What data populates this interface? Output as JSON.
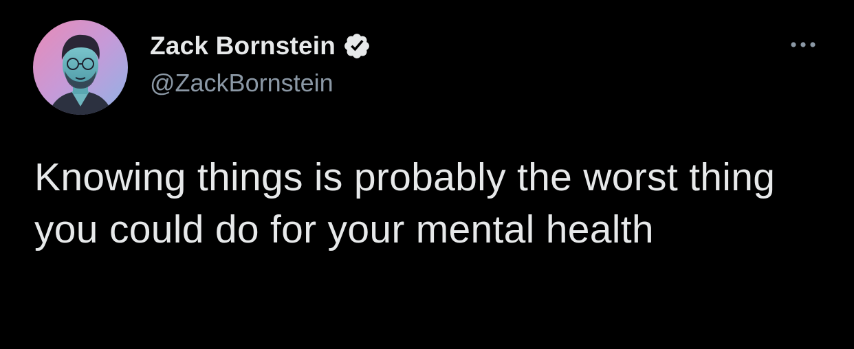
{
  "tweet": {
    "author": {
      "display_name": "Zack Bornstein",
      "handle": "@ZackBornstein",
      "verified": true
    },
    "text": "Knowing things is probably the worst thing you could do for your mental health"
  },
  "icons": {
    "verified": "verified-badge-icon",
    "more": "more-horizontal-icon",
    "avatar": "user-avatar"
  },
  "colors": {
    "background": "#000000",
    "primary_text": "#e7e9ea",
    "secondary_text": "#8b98a5",
    "badge_fill": "#e7e9ea",
    "badge_check": "#000000"
  }
}
